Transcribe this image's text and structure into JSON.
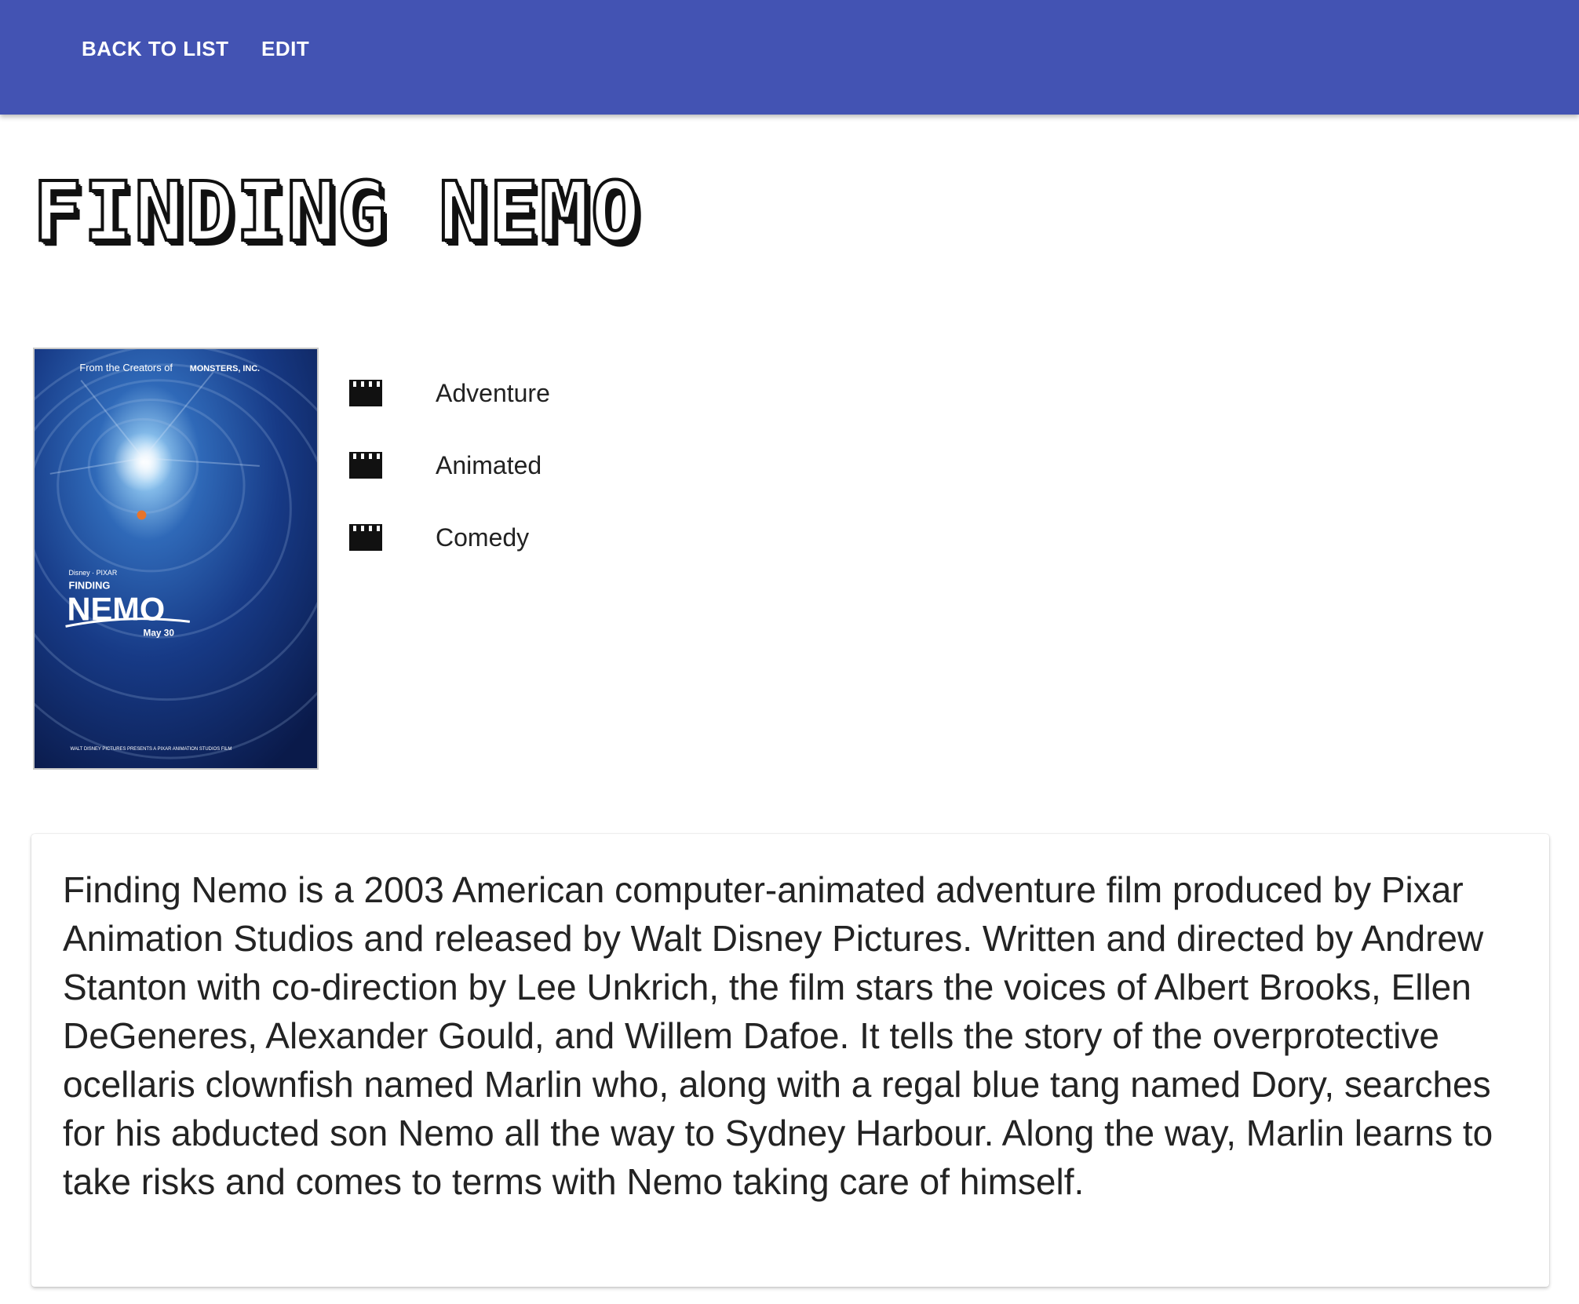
{
  "header": {
    "back_label": "BACK TO LIST",
    "edit_label": "EDIT",
    "background_color": "#4353b3"
  },
  "movie": {
    "title": "FINDING NEMO",
    "poster": {
      "top_line": "From the Creators of",
      "top_brand": "MONSTERS, INC.",
      "studio_line": "Disney · PIXAR",
      "title_small": "FINDING",
      "title_large": "NEMO",
      "release_date": "May 30",
      "bottom_line": "WALT DISNEY PICTURES PRESENTS A PIXAR ANIMATION STUDIOS FILM"
    },
    "genres": [
      {
        "label": "Adventure",
        "icon": "clapperboard-icon"
      },
      {
        "label": "Animated",
        "icon": "clapperboard-icon"
      },
      {
        "label": "Comedy",
        "icon": "clapperboard-icon"
      }
    ],
    "description": "Finding Nemo is a 2003 American computer-animated adventure film produced by Pixar Animation Studios and released by Walt Disney Pictures. Written and directed by Andrew Stanton with co-direction by Lee Unkrich, the film stars the voices of Albert Brooks, Ellen DeGeneres, Alexander Gould, and Willem Dafoe. It tells the story of the overprotective ocellaris clownfish named Marlin who, along with a regal blue tang named Dory, searches for his abducted son Nemo all the way to Sydney Harbour. Along the way, Marlin learns to take risks and comes to terms with Nemo taking care of himself."
  }
}
